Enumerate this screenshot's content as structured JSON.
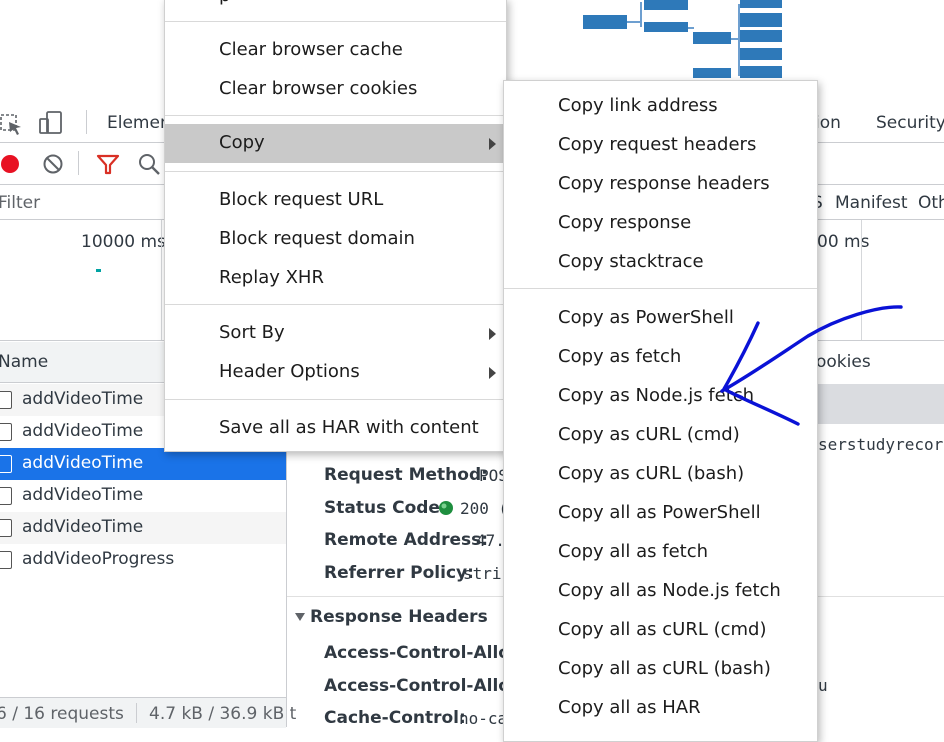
{
  "devtools": {
    "tabs": {
      "elements": "Elemen",
      "application": "ion",
      "security": "Security"
    },
    "filter_placeholder": "Filter",
    "type_filters": {
      "js": "S",
      "manifest": "Manifest",
      "other": "Oth"
    },
    "timeline": {
      "label_left": "10000 ms",
      "label_right": "00 ms"
    },
    "list": {
      "header": "Name",
      "rows": [
        "addVideoTime",
        "addVideoTime",
        "addVideoTime",
        "addVideoTime",
        "addVideoTime",
        "addVideoProgress"
      ],
      "selected_index": 2
    },
    "status": {
      "requests": "6 / 16 requests",
      "size": "4.7 kB / 36.9 kB t"
    },
    "detail_tabs": {
      "cookies": "ookies"
    },
    "request_url_fragment": "serstudyrecor",
    "general": {
      "method_label": "Request Method:",
      "method_value": "POS",
      "status_label": "Status Code:",
      "status_value": "200 (",
      "remote_label": "Remote Address:",
      "remote_value": "47.",
      "referrer_label": "Referrer Policy:",
      "referrer_value": "stri"
    },
    "response_headers": {
      "title": "Response Headers",
      "h1": "Access-Control-Allow",
      "h2": "Access-Control-Allow",
      "h3_label": "Cache-Control:",
      "h3_value": "no-ca"
    },
    "bottom_right_fragment": "u"
  },
  "context_menu": {
    "top_partial": "p",
    "items": {
      "clear_cache": "Clear browser cache",
      "clear_cookies": "Clear browser cookies",
      "copy": "Copy",
      "block_url": "Block request URL",
      "block_domain": "Block request domain",
      "replay_xhr": "Replay XHR",
      "sort_by": "Sort By",
      "header_options": "Header Options",
      "save_har": "Save all as HAR with content"
    }
  },
  "copy_submenu": {
    "items": [
      "Copy link address",
      "Copy request headers",
      "Copy response headers",
      "Copy response",
      "Copy stacktrace",
      "Copy as PowerShell",
      "Copy as fetch",
      "Copy as Node.js fetch",
      "Copy as cURL (cmd)",
      "Copy as cURL (bash)",
      "Copy all as PowerShell",
      "Copy all as fetch",
      "Copy all as Node.js fetch",
      "Copy all as cURL (cmd)",
      "Copy all as cURL (bash)",
      "Copy all as HAR"
    ]
  },
  "colors": {
    "selection": "#1a73e8",
    "record": "#e81123",
    "filter_icon": "#d93025",
    "menu_highlight": "#c9c9c9",
    "annotation": "#0a12d6",
    "status_ok": "#1e8e3e"
  },
  "icons": [
    "inspect-icon",
    "device-toggle-icon",
    "record-icon",
    "clear-icon",
    "filter-icon",
    "search-icon",
    "submenu-arrow-icon",
    "status-dot-icon",
    "collapse-triangle-icon"
  ]
}
